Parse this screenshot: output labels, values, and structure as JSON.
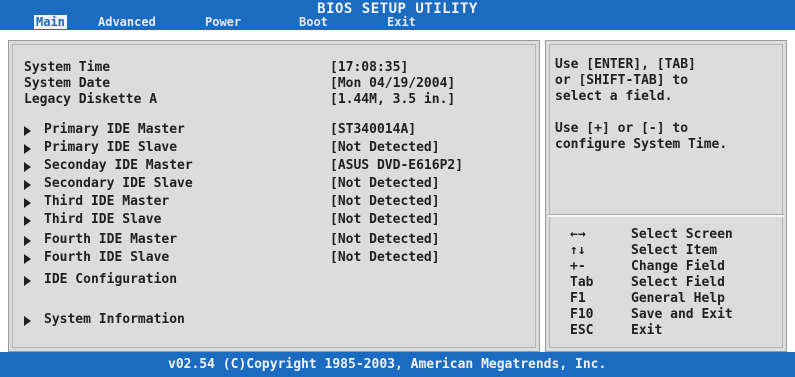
{
  "title": "BIOS SETUP UTILITY",
  "tabs": [
    {
      "label": "Main",
      "active": true
    },
    {
      "label": "Advanced",
      "active": false
    },
    {
      "label": "Power",
      "active": false
    },
    {
      "label": "Boot",
      "active": false
    },
    {
      "label": "Exit",
      "active": false
    }
  ],
  "settings": {
    "system_time": {
      "label": "System Time",
      "value": "[17:08:35]"
    },
    "system_date": {
      "label": "System Date",
      "value": "[Mon 04/19/2004]"
    },
    "legacy_diskette": {
      "label": "Legacy Diskette A",
      "value": "[1.44M, 3.5 in.]"
    }
  },
  "submenus": [
    {
      "label": "Primary IDE Master",
      "value": "[ST340014A]"
    },
    {
      "label": "Primary IDE Slave",
      "value": "[Not Detected]"
    },
    {
      "label": "Seconday IDE Master",
      "value": "[ASUS DVD-E616P2]"
    },
    {
      "label": "Secondary IDE Slave",
      "value": "[Not Detected]"
    },
    {
      "label": "Third IDE Master",
      "value": "[Not Detected]"
    },
    {
      "label": "Third IDE Slave",
      "value": "[Not Detected]"
    },
    {
      "label": "Fourth IDE Master",
      "value": "[Not Detected]"
    },
    {
      "label": "Fourth IDE Slave",
      "value": "[Not Detected]"
    },
    {
      "label": "IDE Configuration",
      "value": ""
    },
    {
      "label": "System Information",
      "value": ""
    }
  ],
  "help": {
    "lines": [
      "Use [ENTER], [TAB]",
      "or [SHIFT-TAB] to",
      "select a field.",
      "",
      "Use [+] or [-] to",
      "configure System Time."
    ],
    "keys": [
      {
        "key": "←→",
        "desc": "Select Screen"
      },
      {
        "key": "↑↓",
        "desc": "Select Item"
      },
      {
        "key": "+-",
        "desc": "Change Field"
      },
      {
        "key": "Tab",
        "desc": "Select Field"
      },
      {
        "key": "F1",
        "desc": "General Help"
      },
      {
        "key": "F10",
        "desc": "Save and Exit"
      },
      {
        "key": "ESC",
        "desc": "Exit"
      }
    ]
  },
  "footer": "v02.54 (C)Copyright 1985-2003, American Megatrends, Inc.",
  "colors": {
    "bar": "#1b6cc0",
    "panel": "#dcdcdc",
    "text": "#202020"
  }
}
